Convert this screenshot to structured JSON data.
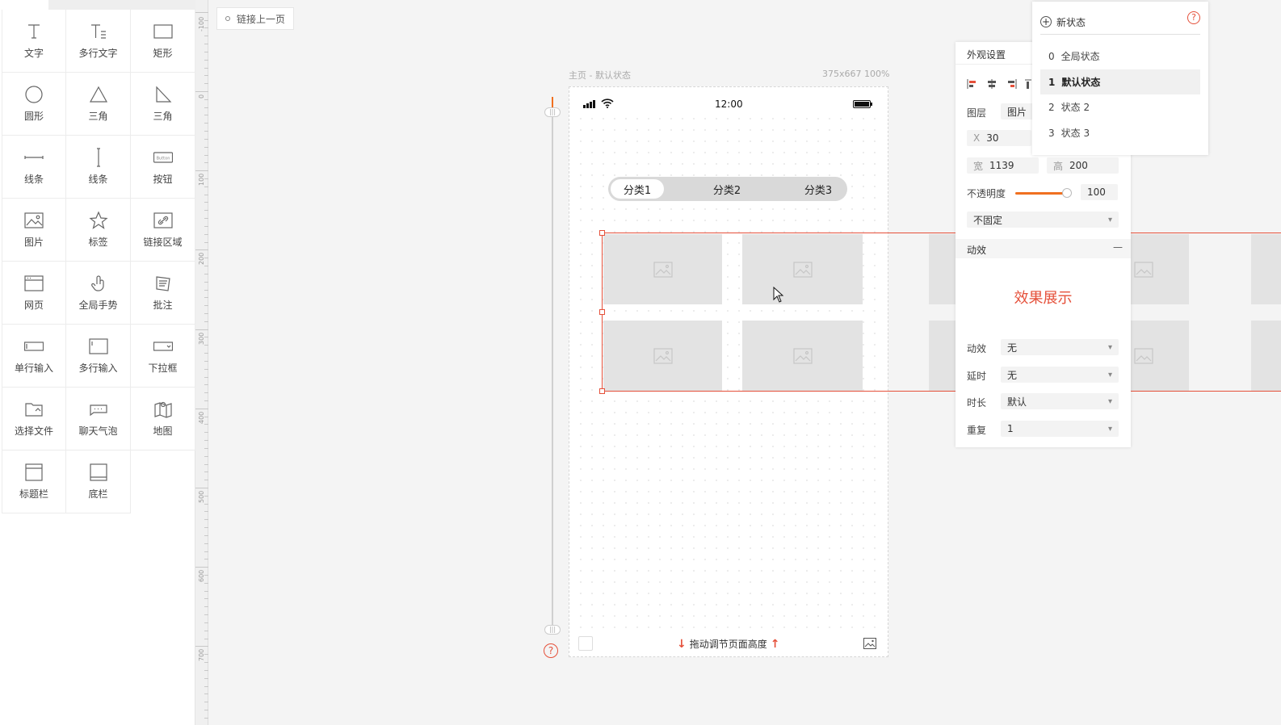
{
  "tools": [
    {
      "label": "文字",
      "icon": "text-icon"
    },
    {
      "label": "多行文字",
      "icon": "multiline-text-icon"
    },
    {
      "label": "矩形",
      "icon": "rectangle-icon"
    },
    {
      "label": "圆形",
      "icon": "circle-icon"
    },
    {
      "label": "三角",
      "icon": "triangle-icon"
    },
    {
      "label": "三角",
      "icon": "right-triangle-icon"
    },
    {
      "label": "线条",
      "icon": "horizontal-line-icon"
    },
    {
      "label": "线条",
      "icon": "vertical-line-icon"
    },
    {
      "label": "按钮",
      "icon": "button-icon",
      "icon_text": "Button"
    },
    {
      "label": "图片",
      "icon": "image-icon"
    },
    {
      "label": "标签",
      "icon": "star-icon"
    },
    {
      "label": "链接区域",
      "icon": "link-area-icon"
    },
    {
      "label": "网页",
      "icon": "webpage-icon"
    },
    {
      "label": "全局手势",
      "icon": "gesture-icon"
    },
    {
      "label": "批注",
      "icon": "annotation-icon"
    },
    {
      "label": "单行输入",
      "icon": "single-input-icon"
    },
    {
      "label": "多行输入",
      "icon": "multi-input-icon"
    },
    {
      "label": "下拉框",
      "icon": "dropdown-icon"
    },
    {
      "label": "选择文件",
      "icon": "file-select-icon"
    },
    {
      "label": "聊天气泡",
      "icon": "chat-bubble-icon"
    },
    {
      "label": "地图",
      "icon": "map-icon"
    },
    {
      "label": "标题栏",
      "icon": "title-bar-icon"
    },
    {
      "label": "底栏",
      "icon": "bottom-bar-icon"
    }
  ],
  "ruler": [
    "-100",
    "0",
    "100",
    "200",
    "300",
    "400",
    "500",
    "600",
    "700"
  ],
  "back_link": "链接上一页",
  "canvas": {
    "page_label": "主页 - 默认状态",
    "page_size": "375x667 100%",
    "status_time": "12:00",
    "tabs": [
      "分类1",
      "分类2",
      "分类3"
    ],
    "drag_hint": "拖动调节页面高度",
    "help": "?"
  },
  "appearance": {
    "title": "外观设置",
    "layer_label": "图层",
    "layer_value": "图片",
    "x_label": "X",
    "x_value": "30",
    "w_label": "宽",
    "w_value": "1139",
    "h_label": "高",
    "h_value": "200",
    "opacity_label": "不透明度",
    "opacity_value": "100",
    "position_value": "不固定",
    "effects_title": "动效",
    "effects_collapse": "—",
    "demo": "效果展示",
    "anim_label": "动效",
    "anim_value": "无",
    "delay_label": "延时",
    "delay_value": "无",
    "duration_label": "时长",
    "duration_value": "默认",
    "repeat_label": "重复",
    "repeat_value": "1"
  },
  "states": {
    "new_label": "新状态",
    "help": "?",
    "items": [
      {
        "index": "0",
        "name": "全局状态"
      },
      {
        "index": "1",
        "name": "默认状态"
      },
      {
        "index": "2",
        "name": "状态 2"
      },
      {
        "index": "3",
        "name": "状态 3"
      }
    ]
  },
  "colors": {
    "accent": "#e5503a",
    "slider": "#f07020"
  }
}
